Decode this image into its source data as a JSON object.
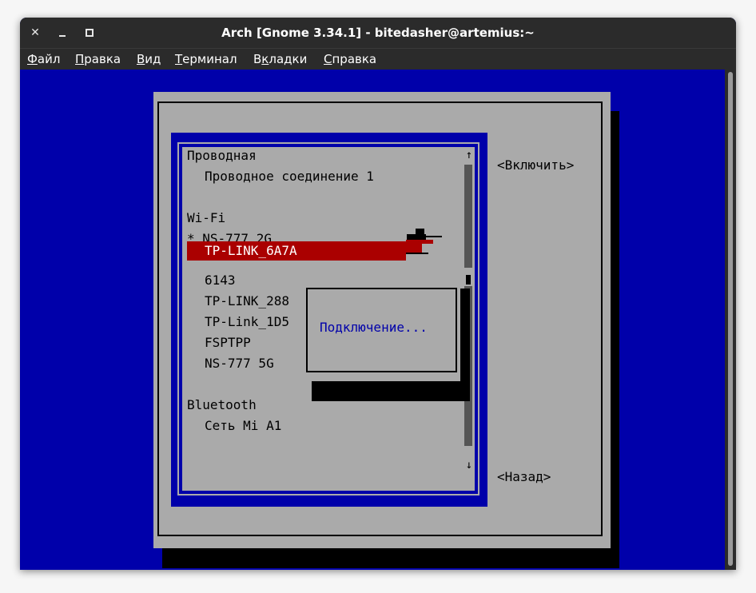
{
  "window": {
    "title": "Arch [Gnome 3.34.1] - bitedasher@artemius:~",
    "controls": {
      "close": "✕"
    }
  },
  "menubar": [
    {
      "label_u": "Ф",
      "label_rest": "айл"
    },
    {
      "label_u": "П",
      "label_rest": "равка"
    },
    {
      "label_u": "В",
      "label_rest": "ид"
    },
    {
      "label_u": "Т",
      "label_rest": "ерминал"
    },
    {
      "label_pre": "В",
      "label_u": "к",
      "label_rest": "ладки"
    },
    {
      "label_u": "С",
      "label_rest": "правка"
    }
  ],
  "nmtui": {
    "sections": {
      "wired": "Проводная",
      "wired_conn": "Проводное соединение 1",
      "wifi": "Wi-Fi",
      "wifi_active": "* NS-777 2G",
      "wifi_selected": "TP-LINK_6A7A",
      "wifi_items": [
        "6143",
        "TP-LINK_288",
        "TP-Link_1D5",
        "FSPTPP",
        "NS-777 5G"
      ],
      "bluetooth": "Bluetooth",
      "bt_item": "Сеть Mi A1"
    },
    "scroll": {
      "up": "↑",
      "down": "↓"
    },
    "buttons": {
      "activate": "<Включить>",
      "back": "<Назад>"
    },
    "popup": {
      "message": "Подключение..."
    }
  },
  "colors": {
    "terminal_bg": "#0000aa",
    "dialog_bg": "#aaaaaa",
    "selection": "#aa0000",
    "titlebar": "#2b2b2b"
  }
}
